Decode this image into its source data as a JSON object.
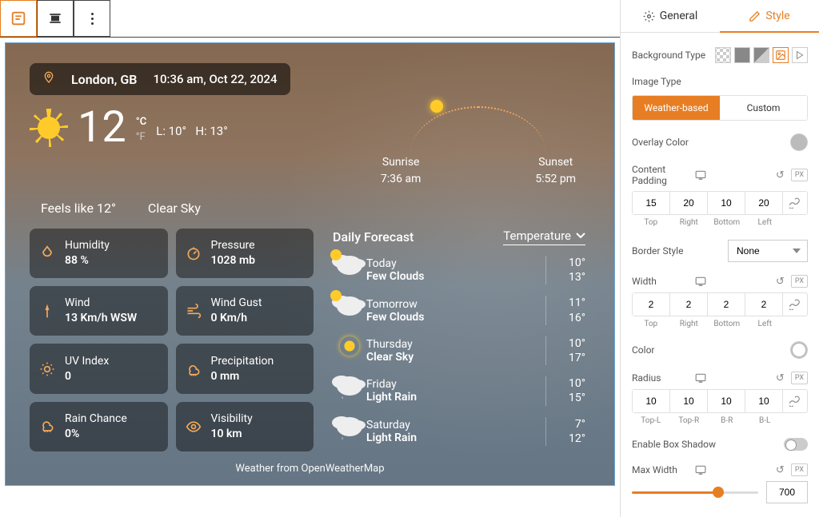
{
  "weather": {
    "location": "London, GB",
    "datetime": "10:36 am, Oct 22, 2024",
    "temp": "12",
    "unit_c": "°C",
    "unit_f": "°F",
    "low": "L: 10°",
    "high": "H: 13°",
    "sunrise_label": "Sunrise",
    "sunrise": "7:36 am",
    "sunset_label": "Sunset",
    "sunset": "5:52 pm",
    "feels_like": "Feels like 12°",
    "condition": "Clear Sky",
    "metrics": [
      {
        "label": "Humidity",
        "value": "88 %",
        "icon": "humidity"
      },
      {
        "label": "Pressure",
        "value": "1028 mb",
        "icon": "pressure"
      },
      {
        "label": "Wind",
        "value": "13 Km/h WSW",
        "icon": "wind"
      },
      {
        "label": "Wind Gust",
        "value": "0 Km/h",
        "icon": "gust"
      },
      {
        "label": "UV Index",
        "value": "0",
        "icon": "uv"
      },
      {
        "label": "Precipitation",
        "value": "0 mm",
        "icon": "precip"
      },
      {
        "label": "Rain Chance",
        "value": "0%",
        "icon": "rain"
      },
      {
        "label": "Visibility",
        "value": "10 km",
        "icon": "visibility"
      }
    ],
    "forecast_title": "Daily Forecast",
    "forecast_selector": "Temperature",
    "forecast": [
      {
        "day": "Today",
        "cond": "Few Clouds",
        "hi": "10°",
        "lo": "13°",
        "icon": "part"
      },
      {
        "day": "Tomorrow",
        "cond": "Few Clouds",
        "hi": "11°",
        "lo": "16°",
        "icon": "part"
      },
      {
        "day": "Thursday",
        "cond": "Clear Sky",
        "hi": "10°",
        "lo": "17°",
        "icon": "sunny"
      },
      {
        "day": "Friday",
        "cond": "Light Rain",
        "hi": "10°",
        "lo": "15°",
        "icon": "rain"
      },
      {
        "day": "Saturday",
        "cond": "Light Rain",
        "hi": "7°",
        "lo": "12°",
        "icon": "rain"
      }
    ],
    "attribution": "Weather from OpenWeatherMap"
  },
  "sidebar": {
    "tabs": {
      "general": "General",
      "style": "Style"
    },
    "bg_type_label": "Background Type",
    "image_type_label": "Image Type",
    "image_type_opts": {
      "weather": "Weather-based",
      "custom": "Custom"
    },
    "overlay_color_label": "Overlay Color",
    "content_padding_label": "Content Padding",
    "padding": {
      "top": "15",
      "right": "20",
      "bottom": "10",
      "left": "20"
    },
    "padding_labels": {
      "top": "Top",
      "right": "Right",
      "bottom": "Bottom",
      "left": "Left"
    },
    "border_style_label": "Border Style",
    "border_style_value": "None",
    "width_label": "Width",
    "width": {
      "top": "2",
      "right": "2",
      "bottom": "2",
      "left": "2"
    },
    "color_label": "Color",
    "radius_label": "Radius",
    "radius": {
      "tl": "10",
      "tr": "10",
      "br": "10",
      "bl": "10"
    },
    "radius_labels": {
      "tl": "Top-L",
      "tr": "Top-R",
      "br": "B-R",
      "bl": "B-L"
    },
    "box_shadow_label": "Enable Box Shadow",
    "max_width_label": "Max Width",
    "max_width_value": "700",
    "unit_px": "PX"
  }
}
